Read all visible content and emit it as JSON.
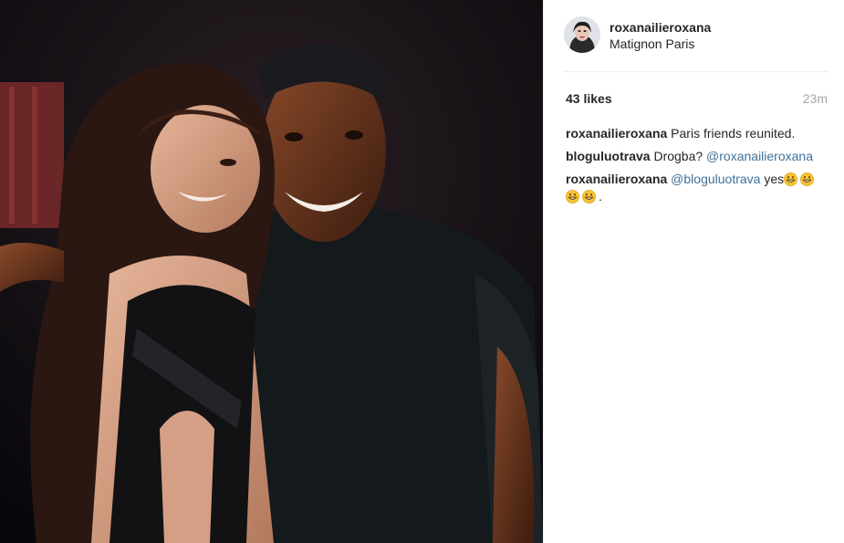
{
  "post": {
    "author": "roxanailieroxana",
    "location": "Matignon Paris",
    "likes": "43 likes",
    "time": "23m"
  },
  "comments": [
    {
      "user": "roxanailieroxana",
      "text": "Paris friends reunited."
    },
    {
      "user": "bloguluotrava",
      "text": "Drogba?",
      "mention": "@roxanailieroxana"
    },
    {
      "user": "roxanailieroxana",
      "mention": "@bloguluotrava",
      "text": "yes",
      "suffix": "."
    }
  ],
  "emoji_icon": "grinning-face-icon",
  "colors": {
    "mention": "#3f729b",
    "text": "#262626",
    "muted": "#a5a7aa",
    "divider": "#efefef"
  }
}
